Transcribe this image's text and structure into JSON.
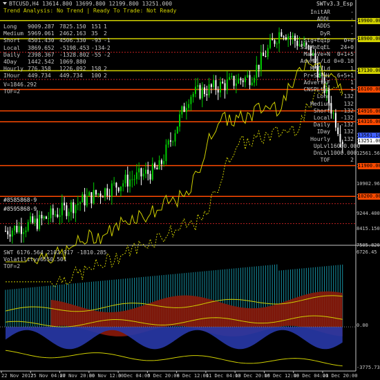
{
  "header": {
    "symbol_line": "BTCUSD,H4  13614.800 13699.800 12199.800 13251.000",
    "indicator_name": "SWTv3.3_Esp",
    "status_line": "Trend Analysis: No Trend | Ready To Trade: Not Ready"
  },
  "stats_left": [
    {
      "label": "Long",
      "a": "9009.287",
      "b": "7825.150",
      "c": "151",
      "d": "1"
    },
    {
      "label": "Medium",
      "a": "5969.061",
      "b": "2462.163",
      "c": "35",
      "d": "2"
    },
    {
      "label": "Short",
      "a": "4501.430",
      "b": "4506.330",
      "c": "-93",
      "d": "-1"
    },
    {
      "label": "Local",
      "a": "3869.652",
      "b": "-5198.453",
      "c": "-134",
      "d": "-2"
    },
    {
      "label": "Daily",
      "a": "2398.367",
      "b": "-1328.802",
      "c": "-55",
      "d": "-2"
    },
    {
      "label": "4Day",
      "a": "1442.542",
      "b": "1069.880",
      "c": "",
      "d": ""
    },
    {
      "label": "Hourly",
      "a": "776.358",
      "b": "1226.092",
      "c": "158",
      "d": "2"
    },
    {
      "label": "IHour",
      "a": "449.734",
      "b": "449.734",
      "c": "100",
      "d": "2"
    }
  ],
  "stats_left_extra": [
    "V=1846.292",
    "TOF=2"
  ],
  "stats_right": [
    {
      "label": "InitAR",
      "value": "-"
    },
    {
      "label": "ADDL",
      "value": "-"
    },
    {
      "label": "ADDS",
      "value": "-"
    },
    {
      "label": "DyR",
      "value": "-"
    },
    {
      "label": "Sig+EqIp",
      "value": "0+0"
    },
    {
      "label": "SigMnEqEL",
      "value": "24+0"
    },
    {
      "label": "Max+Ve+N",
      "value": "0+1+5"
    },
    {
      "label": "AdvMWL/Ld",
      "value": "0+0.10"
    },
    {
      "label": "MMT/Ld",
      "value": "1"
    },
    {
      "label": "Pr+St+Hi",
      "value": "6+5+1"
    },
    {
      "label": "AdvertkF",
      "value": "1"
    },
    {
      "label": "CNSPLtuz",
      "value": "1"
    },
    {
      "label": "Long",
      "value": "132"
    },
    {
      "label": "Medium",
      "value": "132"
    },
    {
      "label": "Short",
      "value": "-132"
    },
    {
      "label": "Local",
      "value": "-132"
    },
    {
      "label": "Daily",
      "value": "-132"
    },
    {
      "label": "IDay",
      "value": "132"
    },
    {
      "label": "Hourly",
      "value": "132"
    },
    {
      "label": "UpLvl",
      "value": "16000.000"
    },
    {
      "label": "DnLvl",
      "value": "1000.000"
    },
    {
      "label": "TOF",
      "value": "2"
    }
  ],
  "price_axis": [
    "19900.000",
    "18900.000",
    "17130.000",
    "16100.000",
    "14916.000",
    "14316.000",
    "13561.100",
    "13251.000",
    "12561.560",
    "11900.000",
    "10902.960",
    "10200.000",
    "9244.400",
    "8415.150",
    "7505.820"
  ],
  "price_tags": [
    {
      "label": "19900.000",
      "color": "#d0d000"
    },
    {
      "label": "18900.000",
      "color": "#d0d000"
    },
    {
      "label": "17130.000",
      "color": "#d0d000"
    },
    {
      "label": "16100.000",
      "color": "#ff4a00"
    },
    {
      "label": "14916.000",
      "color": "#ff4a00"
    },
    {
      "label": "14316.000",
      "color": "#ff4a00"
    },
    {
      "label": "13561.100",
      "color": "#4060ff"
    },
    {
      "label": "13251.000",
      "color": "#ffffff"
    },
    {
      "label": "11900.000",
      "color": "#ff4a00"
    },
    {
      "label": "10200.000",
      "color": "#ff4a00"
    }
  ],
  "chart_labels": {
    "left_a": "#8585868-9",
    "left_b": "#8595868-9",
    "left_c": "#8554 #"
  },
  "sub_window": {
    "title": "SWT 6176.564 2102.917 -1810.285",
    "volatility": "Volatility=6550.501",
    "tof": "TOF=2",
    "axis": [
      "6726.45",
      "0.00",
      "-3775.731"
    ]
  },
  "time_axis": [
    "22 Nov 2017",
    "25 Nov 04:00",
    "27 Nov 20:00",
    "30 Nov 12:00",
    "3 Dec 04:00",
    "5 Dec 20:00",
    "8 Dec 12:00",
    "11 Dec 04:00",
    "13 Dec 20:00",
    "16 Dec 12:00",
    "19 Dec 04:00",
    "21 Dec 20:00"
  ],
  "colors": {
    "bull": "#00d000",
    "bear": "#ffffff",
    "orange": "#ff4a00",
    "yellow": "#d0d000",
    "blue": "#2838a8",
    "fill_red": "#8b1a0a",
    "fill_cyan": "#1ec0d8"
  },
  "chart_data": {
    "type": "line",
    "title": "BTCUSD,H4",
    "x": [
      "22 Nov 2017",
      "25 Nov 04:00",
      "27 Nov 20:00",
      "30 Nov 12:00",
      "3 Dec 04:00",
      "5 Dec 20:00",
      "8 Dec 12:00",
      "11 Dec 04:00",
      "13 Dec 20:00",
      "16 Dec 12:00",
      "19 Dec 04:00",
      "21 Dec 20:00"
    ],
    "series": [
      {
        "name": "",
        "values": [
          8300,
          8750,
          9550,
          10350,
          11100,
          11700,
          15800,
          16300,
          16800,
          19400,
          18100,
          13300
        ]
      }
    ],
    "ylim": [
      7505.82,
      20500
    ]
  }
}
